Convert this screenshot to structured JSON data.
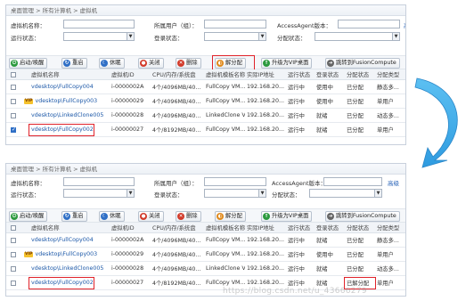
{
  "colors": {
    "accent": "#1c58a8",
    "highlight": "#e0222a",
    "arrow": "#2e9be0"
  },
  "panel1": {
    "breadcrumb": "桌面管理 > 所有计算机 > 虚拟机",
    "filters": {
      "vm_name_label": "虚拟机名称：",
      "user_label": "所属用户（组）：",
      "access_agent_label": "AccessAgent版本：",
      "run_status_label": "运行状态：",
      "login_status_label": "登录状态：",
      "assign_status_label": "分配状态：",
      "search_link": "高"
    },
    "toolbar": {
      "buttons": [
        {
          "label": "启动/唤醒",
          "icon": "power-icon",
          "color": "#2b9a3e"
        },
        {
          "label": "重启",
          "icon": "restart-icon",
          "color": "#2f6fc6"
        },
        {
          "label": "休眠",
          "icon": "hibernate-icon",
          "color": "#2f6fc6"
        },
        {
          "label": "关闭",
          "icon": "shutdown-icon",
          "color": "#d23b2b"
        },
        {
          "label": "删除",
          "icon": "delete-icon",
          "color": "#d23b2b"
        },
        {
          "label": "解分配",
          "icon": "unassign-icon",
          "color": "#e08a1c"
        },
        {
          "label": "升级为VIP桌面",
          "icon": "vip-upgrade-icon",
          "color": "#2b9a3e"
        },
        {
          "label": "跳转到FusionCompute",
          "icon": "jump-icon",
          "color": "#666666"
        }
      ]
    },
    "columns": [
      "虚拟机名称",
      "虚拟机ID",
      "CPU/内存/系统盘",
      "虚拟机模板名称",
      "实际IP地址",
      "运行状态",
      "登录状态",
      "分配状态",
      "分配类型"
    ],
    "rows": [
      {
        "checked": false,
        "vip": false,
        "name": "vdesktop\\FullCopy004",
        "id": "i-0000002A",
        "spec": "4个/4096MB/40...",
        "template": "FullCopy VM...",
        "ip": "192.168.20...",
        "run": "运行中",
        "login": "使用中",
        "assign": "已分配",
        "type": "静态多..."
      },
      {
        "checked": false,
        "vip": true,
        "name": "vdesktop\\FullCopy003",
        "id": "i-00000029",
        "spec": "4个/4096MB/40...",
        "template": "FullCopy VM...",
        "ip": "192.168.20...",
        "run": "运行中",
        "login": "使用中",
        "assign": "已分配",
        "type": "单用户"
      },
      {
        "checked": false,
        "vip": false,
        "name": "vdesktop\\LinkedClone005",
        "id": "i-00000028",
        "spec": "4个/4096MB/40...",
        "template": "LinkedClone VM...",
        "ip": "192.168.20...",
        "run": "运行中",
        "login": "就绪",
        "assign": "已分配",
        "type": "动态多..."
      },
      {
        "checked": true,
        "vip": false,
        "name": "vdesktop\\FullCopy002",
        "id": "i-00000027",
        "spec": "4个/8192MB/40...",
        "template": "FullCopy VM...",
        "ip": "192.168.20...",
        "run": "运行中",
        "login": "就绪",
        "assign": "已分配",
        "type": "单用户"
      }
    ]
  },
  "panel2": {
    "breadcrumb": "桌面管理 > 所有计算机 > 虚拟机",
    "filters": {
      "vm_name_label": "虚拟机名称：",
      "user_label": "所属用户（组）：",
      "access_agent_label": "AccessAgent版本：",
      "run_status_label": "运行状态：",
      "login_status_label": "登录状态：",
      "assign_status_label": "分配状态：",
      "search_link": "高级"
    },
    "toolbar": {
      "buttons": [
        {
          "label": "启动/唤醒",
          "icon": "power-icon",
          "color": "#2b9a3e"
        },
        {
          "label": "重启",
          "icon": "restart-icon",
          "color": "#2f6fc6"
        },
        {
          "label": "休眠",
          "icon": "hibernate-icon",
          "color": "#2f6fc6"
        },
        {
          "label": "关闭",
          "icon": "shutdown-icon",
          "color": "#d23b2b"
        },
        {
          "label": "删除",
          "icon": "delete-icon",
          "color": "#d23b2b"
        },
        {
          "label": "解分配",
          "icon": "unassign-icon",
          "color": "#e08a1c"
        },
        {
          "label": "升级为VIP桌面",
          "icon": "vip-upgrade-icon",
          "color": "#2b9a3e"
        },
        {
          "label": "跳转到FusionCompute",
          "icon": "jump-icon",
          "color": "#666666"
        }
      ]
    },
    "columns": [
      "虚拟机名称",
      "虚拟机ID",
      "CPU/内存/系统盘",
      "虚拟机模板名称",
      "实际IP地址",
      "运行状态",
      "登录状态",
      "分配状态",
      "分配类型"
    ],
    "rows": [
      {
        "checked": false,
        "vip": false,
        "name": "vdesktop\\FullCopy004",
        "id": "i-0000002A",
        "spec": "4个/4096MB/40...",
        "template": "FullCopy VM...",
        "ip": "192.168.20...",
        "run": "运行中",
        "login": "就绪",
        "assign": "已分配",
        "type": "静态多..."
      },
      {
        "checked": false,
        "vip": true,
        "name": "vdesktop\\FullCopy003",
        "id": "i-00000029",
        "spec": "4个/4096MB/40...",
        "template": "FullCopy VM...",
        "ip": "192.168.20...",
        "run": "运行中",
        "login": "使用中",
        "assign": "已分配",
        "type": "单用户"
      },
      {
        "checked": false,
        "vip": false,
        "name": "vdesktop\\LinkedClone005",
        "id": "i-00000028",
        "spec": "4个/4096MB/40...",
        "template": "LinkedClone VM...",
        "ip": "192.168.20...",
        "run": "运行中",
        "login": "就绪",
        "assign": "已分配",
        "type": "动态多..."
      },
      {
        "checked": false,
        "vip": false,
        "name": "vdesktop\\FullCopy002",
        "id": "i-00000027",
        "spec": "4个/8192MB/40...",
        "template": "FullCopy VM...",
        "ip": "192.168.20...",
        "run": "运行中",
        "login": "就绪",
        "assign": "已解分配",
        "type": "单用户"
      }
    ]
  },
  "watermark": "https://blog.csdn.net/u_43666279"
}
